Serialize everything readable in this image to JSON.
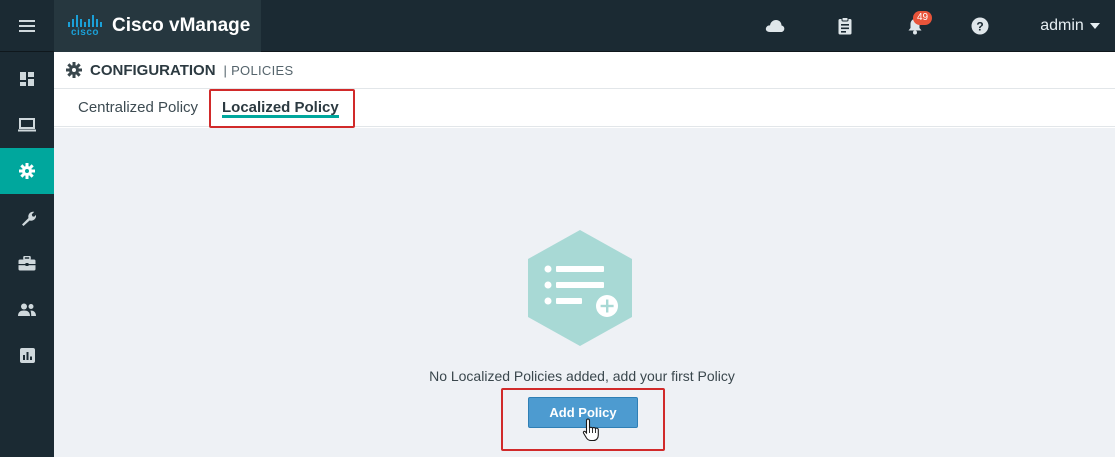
{
  "app": {
    "logo_text": "cisco",
    "title": "Cisco vManage"
  },
  "topbar": {
    "notification_count": "49",
    "user_label": "admin",
    "icons": [
      "menu-icon",
      "cloud-icon",
      "clipboard-icon",
      "bell-icon",
      "help-icon",
      "caret-down-icon"
    ]
  },
  "sidebar": {
    "items": [
      {
        "icon": "dashboard-icon",
        "active": false
      },
      {
        "icon": "monitor-icon",
        "active": false
      },
      {
        "icon": "configuration-gear-icon",
        "active": true
      },
      {
        "icon": "tools-wrench-icon",
        "active": false
      },
      {
        "icon": "maintenance-briefcase-icon",
        "active": false
      },
      {
        "icon": "administration-users-icon",
        "active": false
      },
      {
        "icon": "analytics-chart-icon",
        "active": false
      }
    ]
  },
  "header": {
    "section": "CONFIGURATION",
    "separator": " | ",
    "subsection": "POLICIES"
  },
  "tabs": [
    {
      "label": "Centralized Policy",
      "active": false
    },
    {
      "label": "Localized Policy",
      "active": true
    }
  ],
  "empty_state": {
    "message": "No Localized Policies added, add your first Policy",
    "button_label": "Add Policy"
  },
  "colors": {
    "topbar_bg": "#1b2a33",
    "accent": "#00a79d",
    "button_blue": "#4d9bd0",
    "highlight_red": "#d12a2a",
    "content_bg": "#eef1f5",
    "hexagon": "#a8d9d5"
  }
}
